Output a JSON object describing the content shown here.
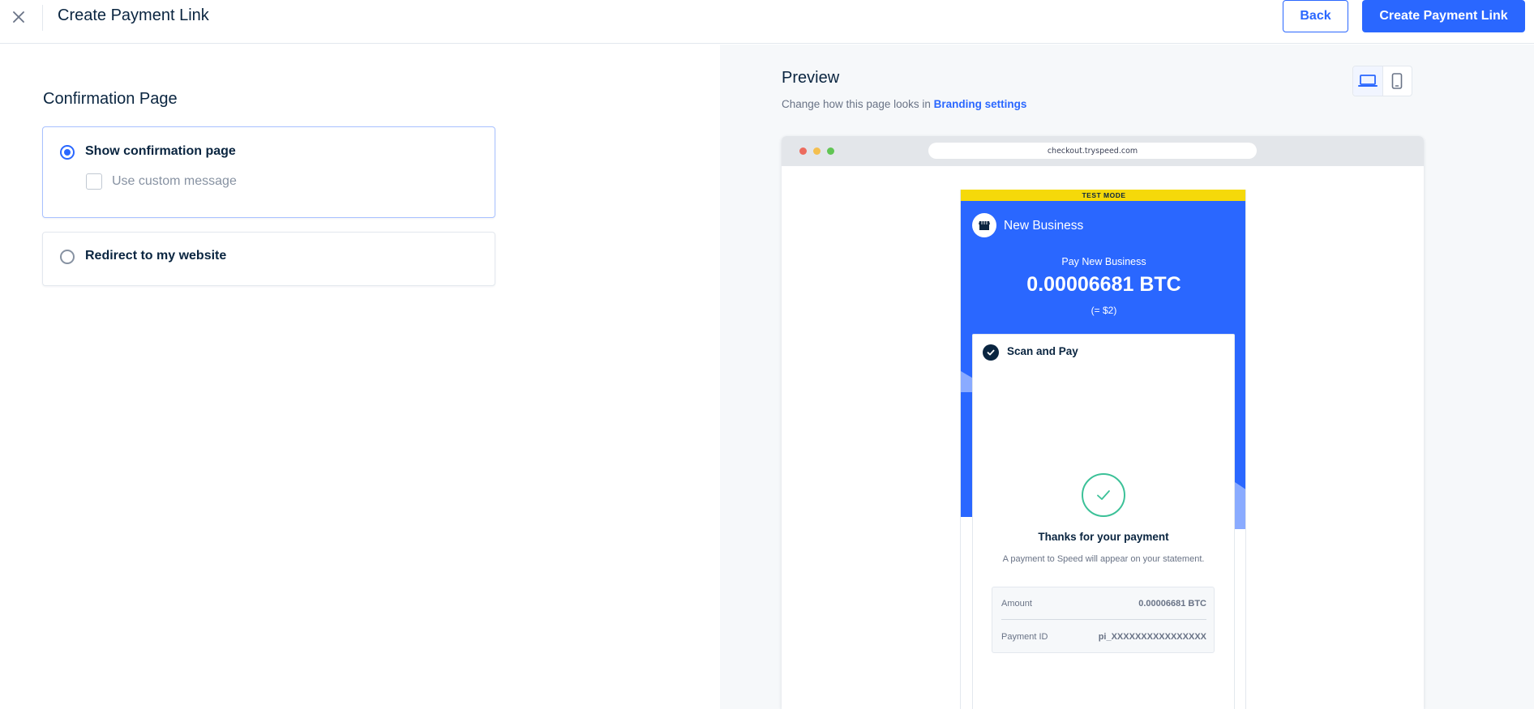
{
  "header": {
    "title": "Create Payment Link",
    "back_label": "Back",
    "create_label": "Create Payment Link",
    "close_icon": "close-icon"
  },
  "form": {
    "section_title": "Confirmation Page",
    "options": [
      {
        "label": "Show confirmation page",
        "selected": true
      },
      {
        "label": "Redirect to my website",
        "selected": false
      }
    ],
    "custom_message_label": "Use custom message",
    "custom_message_checked": false
  },
  "preview": {
    "title": "Preview",
    "subtitle_prefix": "Change how this page looks in",
    "branding_link": "Branding settings",
    "device_modes": [
      "laptop-icon",
      "mobile-icon"
    ],
    "active_device": "laptop-icon",
    "url": "checkout.tryspeed.com",
    "checkout": {
      "test_mode": "TEST MODE",
      "business_name": "New Business",
      "pay_to": "Pay New Business",
      "amount": "0.00006681 BTC",
      "fiat": "(= $2)",
      "step_label": "Scan and Pay",
      "thanks_title": "Thanks for your payment",
      "statement_text": "A payment to Speed will appear on your statement.",
      "details": {
        "amount_label": "Amount",
        "amount_value": "0.00006681 BTC",
        "payment_id_label": "Payment ID",
        "payment_id_value": "pi_XXXXXXXXXXXXXXXX"
      }
    }
  },
  "colors": {
    "accent": "#2a67ff",
    "test_mode": "#f5d90a",
    "success": "#3cc198",
    "text": "#0a2540"
  }
}
